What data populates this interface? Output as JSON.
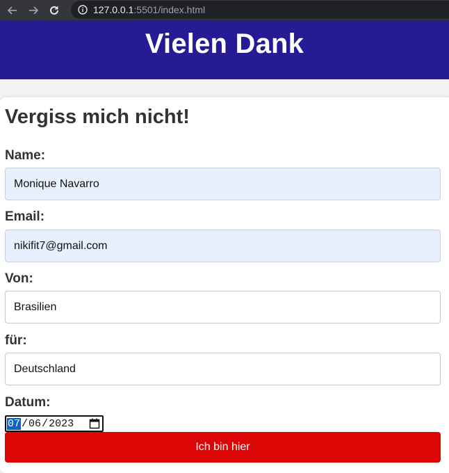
{
  "browser": {
    "url_host": "127.0.0.1",
    "url_rest": ":5501/index.html"
  },
  "header": {
    "title": "Vielen Dank"
  },
  "form": {
    "title": "Vergiss mich nicht!",
    "name": {
      "label": "Name:",
      "value": "Monique Navarro"
    },
    "email": {
      "label": "Email:",
      "value": "nikifit7@gmail.com"
    },
    "von": {
      "label": "Von:",
      "value": "Brasilien"
    },
    "fuer": {
      "label": "für:",
      "value": "Deutschland"
    },
    "datum": {
      "label": "Datum:",
      "month": "07",
      "day": "06",
      "year": "2023",
      "separator": "/"
    },
    "submit_label": "Ich bin hier"
  },
  "colors": {
    "header_bg": "#251b94",
    "button_bg": "#dd0606",
    "autofill_bg": "#e8f0fe"
  }
}
